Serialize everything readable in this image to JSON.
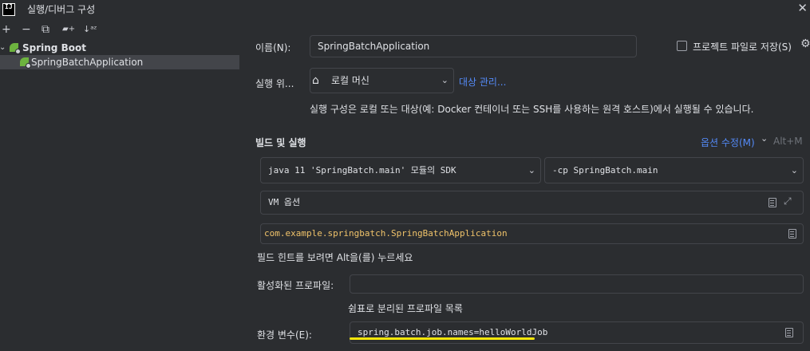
{
  "window": {
    "app_icon_text": "IJ",
    "title": "실행/디버그 구성"
  },
  "toolbar": {
    "add": "+",
    "remove": "−",
    "copy": "⧉",
    "new_folder": "▰+",
    "sort": "↓ᵃᶻ"
  },
  "tree": {
    "group_label": "Spring Boot",
    "item_label": "SpringBatchApplication"
  },
  "form": {
    "name_label": "이름(N):",
    "name_value": "SpringBatchApplication",
    "store_as_file_label": "프로젝트 파일로 저장(S)",
    "run_on_label": "실행 위...",
    "run_on_value": "로컬 머신",
    "manage_targets_link": "대상 관리...",
    "run_on_hint": "실행 구성은 로컬 또는 대상(예: Docker 컨테이너 또는 SSH를 사용하는 원격 호스트)에서 실행될 수 있습니다.",
    "build_run_section": "빌드 및 실행",
    "modify_options_link": "옵션 수정(M)",
    "modify_options_shortcut": "Alt+M",
    "jdk_value": "java 11 'SpringBatch.main' 모듈의 SDK",
    "classpath_value": "-cp SpringBatch.main",
    "vm_options_placeholder": "VM 옵션",
    "main_class_value": "com.example.springbatch.SpringBatchApplication",
    "field_hint": "필드 힌트를 보려면 Alt을(를) 누르세요",
    "active_profiles_label": "활성화된 프로파일:",
    "active_profiles_value": "",
    "profiles_hint": "쉼표로 분리된 프로파일 목록",
    "env_vars_label": "환경 변수(E):",
    "env_vars_value": "spring.batch.job.names=helloWorldJob"
  },
  "colors": {
    "background": "#2b2d30",
    "accent_link": "#548af7",
    "spring_green": "#6db33f",
    "highlight_underline": "#f5e60a",
    "main_class_text": "#f0c36a"
  }
}
